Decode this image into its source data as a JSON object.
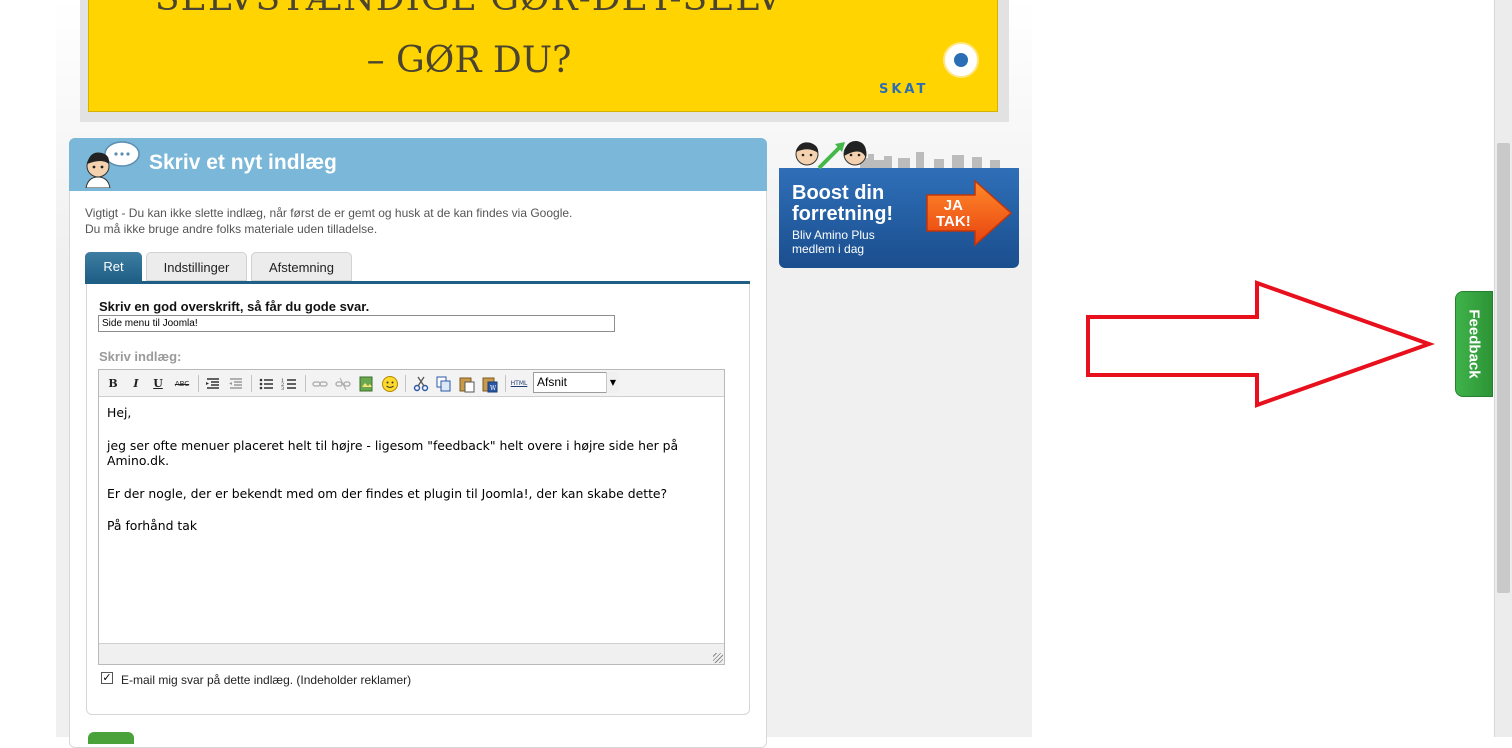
{
  "ad_banner": {
    "line1": "SELVSTÆNDIGE GØR-DET-SELV",
    "line2": "– GØR DU?",
    "brand": "SKAT"
  },
  "panel": {
    "title": "Skriv et nyt indlæg",
    "info_line1": "Vigtigt - Du kan ikke slette indlæg, når først de er gemt og husk at de kan findes via Google.",
    "info_line2": "Du må ikke bruge andre folks materiale uden tilladelse."
  },
  "tabs": [
    {
      "label": "Ret",
      "active": true
    },
    {
      "label": "Indstillinger",
      "active": false
    },
    {
      "label": "Afstemning",
      "active": false
    }
  ],
  "form": {
    "headline_label": "Skriv en god overskrift, så får du gode svar.",
    "headline_value": "Side menu til Joomla!",
    "body_label": "Skriv indlæg:",
    "format_value": "Afsnit",
    "html_label": "HTML",
    "body_paragraphs": [
      "Hej,",
      "jeg ser ofte menuer placeret helt til højre - ligesom \"feedback\" helt overe i højre side her på Amino.dk.",
      "Er der nogle, der er bekendt med om der findes et plugin til Joomla!, der kan skabe dette?",
      "På forhånd tak"
    ],
    "email_checkbox_label": "E-mail mig svar på dette indlæg. (Indeholder reklamer)",
    "email_checked": true
  },
  "boost_ad": {
    "title_line1": "Boost din",
    "title_line2": "forretning!",
    "sub_line1": "Bliv Amino Plus",
    "sub_line2": "medlem i dag",
    "cta_line1": "JA",
    "cta_line2": "TAK!"
  },
  "feedback": {
    "label": "Feedback"
  },
  "colors": {
    "header_blue": "#7ab7d9",
    "tab_active": "#1f5f86",
    "feedback_green": "#3fb34a",
    "annotation_red": "#e8101c"
  }
}
